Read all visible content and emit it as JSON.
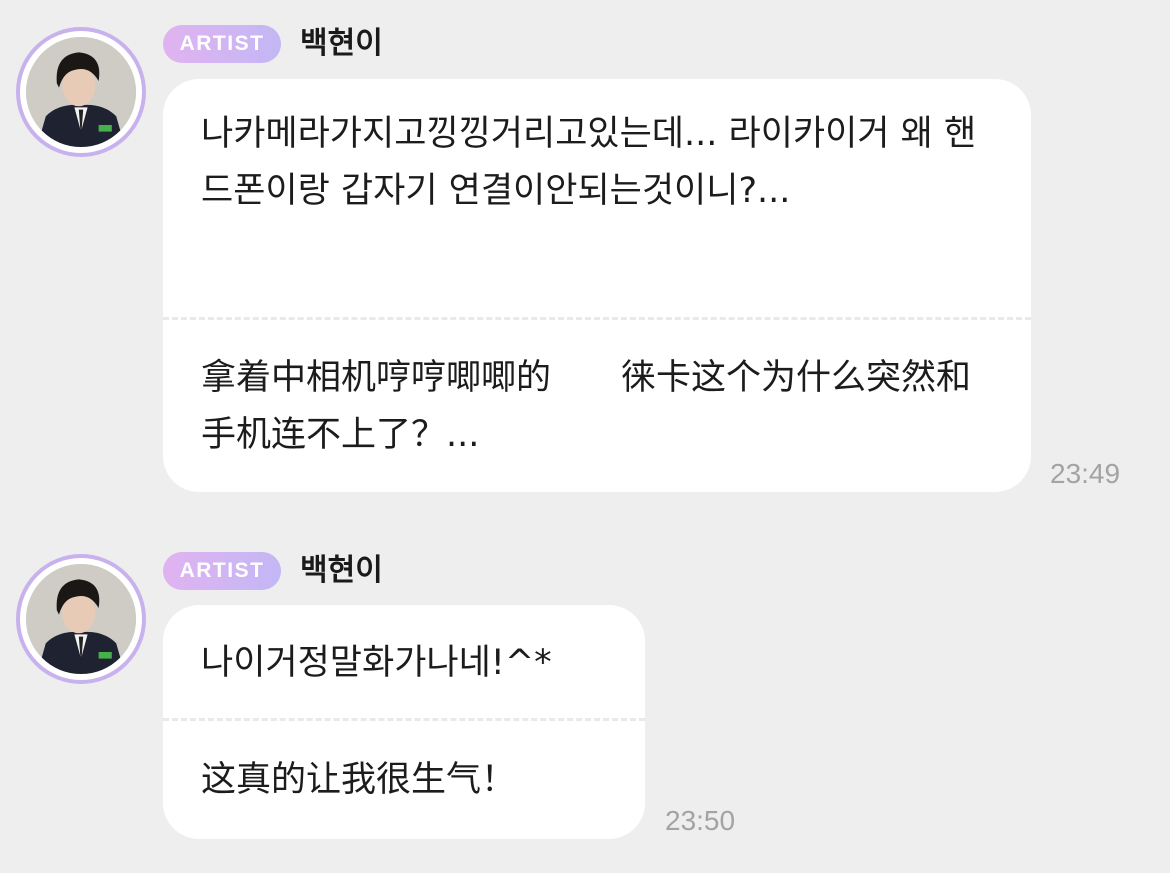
{
  "messages": [
    {
      "badge": "ARTIST",
      "sender": "백현이",
      "original_text": "나카메라가지고낑낑거리고있는데... 라이카이거 왜 핸드폰이랑 갑자기 연결이안되는것이니?...",
      "translated_text": "拿着中相机哼哼唧唧的　　徕卡这个为什么突然和手机连不上了？...",
      "time": "23:49"
    },
    {
      "badge": "ARTIST",
      "sender": "백현이",
      "original_text": "나이거정말화가나네!^*",
      "translated_text": "这真的让我很生气！",
      "time": "23:50"
    }
  ]
}
